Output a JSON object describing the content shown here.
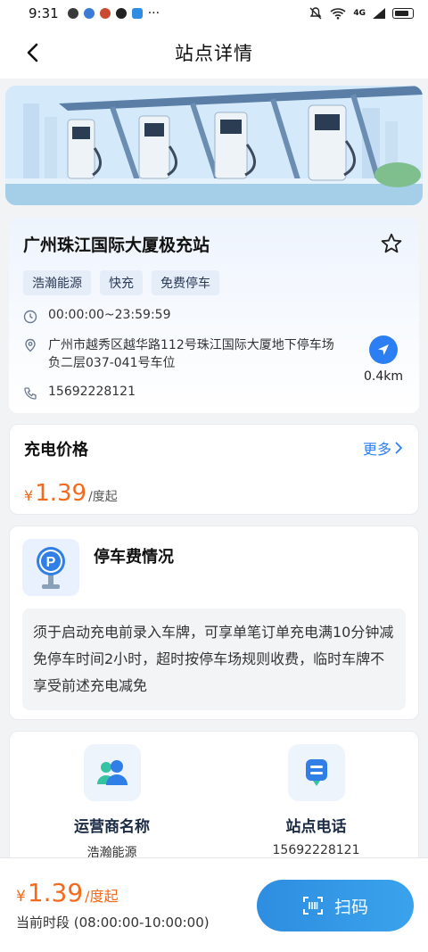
{
  "status_bar": {
    "time": "9:31",
    "network": "4G"
  },
  "nav": {
    "title": "站点详情"
  },
  "station": {
    "name": "广州珠江国际大厦极充站",
    "tags": [
      "浩瀚能源",
      "快充",
      "免费停车"
    ],
    "hours": "00:00:00~23:59:59",
    "address": "广州市越秀区越华路112号珠江国际大厦地下停车场负二层037-041号车位",
    "phone": "15692228121",
    "distance": "0.4km"
  },
  "price_card": {
    "title": "充电价格",
    "more": "更多",
    "currency": "¥",
    "price": "1.39",
    "unit": "/度起"
  },
  "parking": {
    "title": "停车费情况",
    "description": "须于启动充电前录入车牌，可享单笔订单充电满10分钟减免停车时间2小时，超时按停车场规则收费，临时车牌不享受前述充电减免"
  },
  "contacts": {
    "operator_label": "运营商名称",
    "operator_value": "浩瀚能源",
    "phone_label": "站点电话",
    "phone_value": "15692228121"
  },
  "bottom": {
    "currency": "¥",
    "price": "1.39",
    "unit": "/度起",
    "period": "当前时段 (08:00:00-10:00:00)",
    "scan_label": "扫码"
  },
  "colors": {
    "accent": "#2c7ff2",
    "price": "#f26b1d",
    "scan_button": "#3396e6"
  }
}
